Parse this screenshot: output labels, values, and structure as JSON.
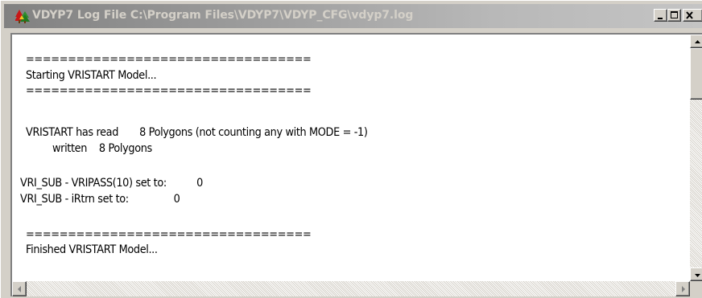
{
  "window": {
    "title": "VDYP7 Log File C:\\Program Files\\VDYP7\\VDYP_CFG\\vdyp7.log",
    "icon": "trees-icon",
    "controls": {
      "minimize": "minimize-icon",
      "maximize": "maximize-icon",
      "close": "close-icon"
    }
  },
  "log": {
    "lines": [
      "==================================",
      "Starting VRISTART Model...",
      "==================================",
      "VRISTART has read       8 Polygons (not counting any with MODE = -1)",
      "written    8 Polygons",
      "VRI_SUB - VRIPASS(10) set to:          0",
      "VRI_SUB - iRtrn set to:               0",
      "==================================",
      "Finished VRISTART Model..."
    ]
  },
  "scrollbars": {
    "vertical": {
      "up": "arrow-up-icon",
      "down": "arrow-down-icon"
    },
    "horizontal": {
      "left": "arrow-left-icon",
      "right": "arrow-right-icon"
    }
  }
}
